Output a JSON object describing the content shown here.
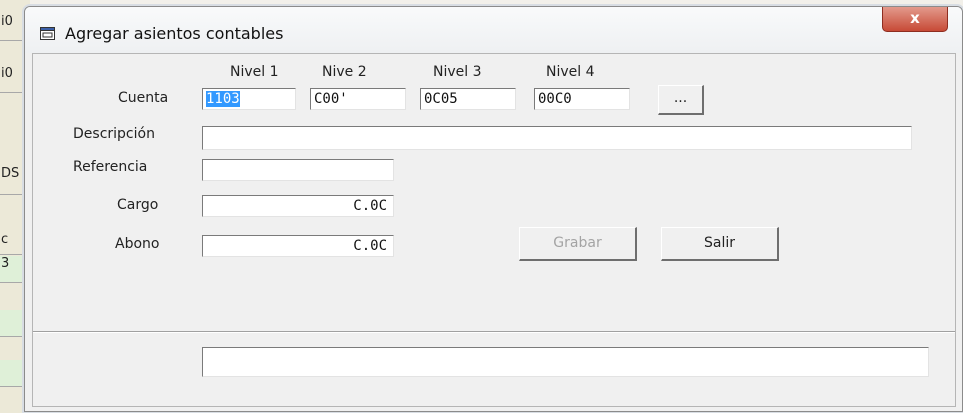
{
  "background": {
    "cells": [
      "i0",
      "i0",
      "DS",
      "c",
      "3",
      "",
      ""
    ]
  },
  "dialog": {
    "title": "Agregar asientos contables",
    "close_label": "x"
  },
  "levels": {
    "headers": [
      "Nivel 1",
      "Nive 2",
      "Nivel 3",
      "Nivel 4"
    ],
    "values": [
      "1103",
      "C00'",
      "0C05",
      "00C0"
    ]
  },
  "form": {
    "cuenta_label": "Cuenta",
    "descripcion_label": "Descripción",
    "descripcion_value": "",
    "referencia_label": "Referencia",
    "referencia_value": "",
    "cargo_label": "Cargo",
    "cargo_value": "C.0C",
    "abono_label": "Abono",
    "abono_value": "C.0C",
    "status_value": ""
  },
  "buttons": {
    "browse_label": "...",
    "grabar_label": "Grabar",
    "salir_label": "Salir"
  }
}
